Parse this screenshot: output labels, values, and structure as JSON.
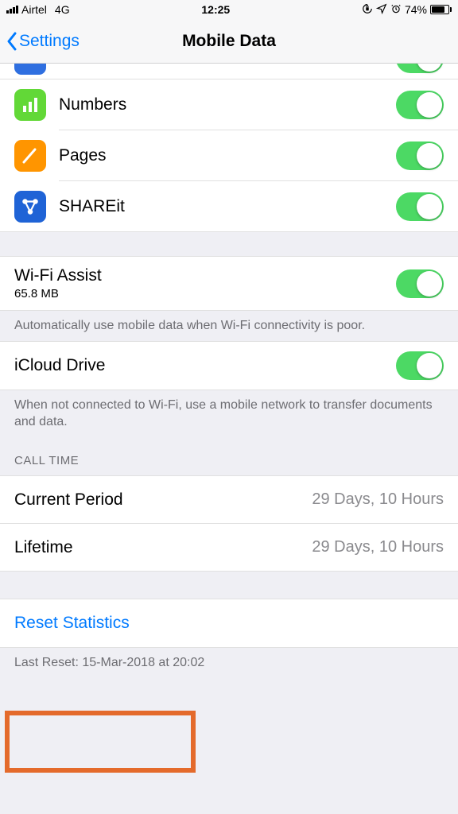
{
  "status": {
    "carrier": "Airtel",
    "network": "4G",
    "time": "12:25",
    "battery_pct": "74%"
  },
  "nav": {
    "back_label": "Settings",
    "title": "Mobile Data"
  },
  "apps": [
    {
      "name": "Numbers",
      "icon": "numbers",
      "color": "#62d837",
      "enabled": true
    },
    {
      "name": "Pages",
      "icon": "pages",
      "color": "#ff9500",
      "enabled": true
    },
    {
      "name": "SHAREit",
      "icon": "shareit",
      "color": "#1f63d6",
      "enabled": true
    }
  ],
  "wifi_assist": {
    "title": "Wi-Fi Assist",
    "usage": "65.8 MB",
    "enabled": true,
    "footer": "Automatically use mobile data when Wi-Fi connectivity is poor."
  },
  "icloud_drive": {
    "title": "iCloud Drive",
    "enabled": true,
    "footer": "When not connected to Wi-Fi, use a mobile network to transfer documents and data."
  },
  "call_time": {
    "header": "CALL TIME",
    "current_label": "Current Period",
    "current_value": "29 Days, 10 Hours",
    "lifetime_label": "Lifetime",
    "lifetime_value": "29 Days, 10 Hours"
  },
  "reset": {
    "label": "Reset Statistics",
    "last_reset": "Last Reset: 15-Mar-2018 at 20:02"
  }
}
